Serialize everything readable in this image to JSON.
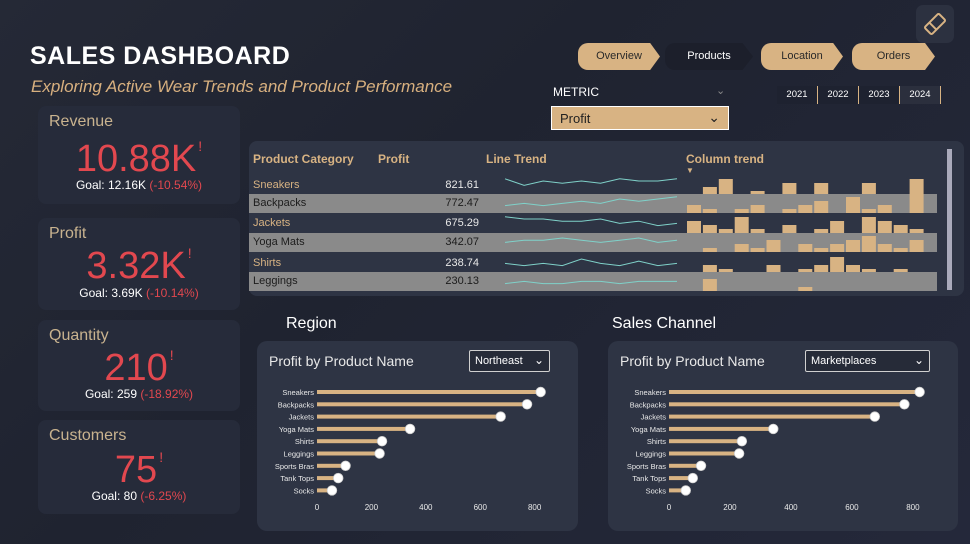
{
  "header": {
    "title": "SALES DASHBOARD",
    "subtitle": "Exploring Active Wear Trends and Product Performance"
  },
  "nav": [
    {
      "label": "Overview",
      "active": false
    },
    {
      "label": "Products",
      "active": true
    },
    {
      "label": "Location",
      "active": false
    },
    {
      "label": "Orders",
      "active": false
    }
  ],
  "metric": {
    "label": "METRIC",
    "selected": "Profit"
  },
  "years": [
    {
      "label": "2021",
      "selected": false
    },
    {
      "label": "2022",
      "selected": false
    },
    {
      "label": "2023",
      "selected": false
    },
    {
      "label": "2024",
      "selected": true
    }
  ],
  "kpis": [
    {
      "label": "Revenue",
      "value": "10.88K",
      "warn": "!",
      "goal_text": "Goal: 12.16K",
      "goal_pct": "(-10.54%)"
    },
    {
      "label": "Profit",
      "value": "3.32K",
      "warn": "!",
      "goal_text": "Goal: 3.69K",
      "goal_pct": "(-10.14%)"
    },
    {
      "label": "Quantity",
      "value": "210",
      "warn": "!",
      "goal_text": "Goal: 259",
      "goal_pct": "(-18.92%)"
    },
    {
      "label": "Customers",
      "value": "75",
      "warn": "!",
      "goal_text": "Goal: 80",
      "goal_pct": "(-6.25%)"
    }
  ],
  "table": {
    "headers": {
      "category": "Product Category",
      "profit": "Profit",
      "line": "Line Trend",
      "column": "Column trend"
    },
    "rows": [
      {
        "category": "Sneakers",
        "profit": "821.61",
        "line": [
          6,
          3,
          5,
          4,
          5,
          4,
          6,
          5,
          5,
          6
        ],
        "cols": [
          0,
          2,
          4,
          0,
          1,
          0,
          3,
          0,
          3,
          0,
          0,
          3,
          0,
          0,
          4
        ]
      },
      {
        "category": "Backpacks",
        "profit": "772.47",
        "line": [
          2,
          3,
          2,
          3,
          4,
          3,
          5,
          4,
          5,
          6
        ],
        "cols": [
          2,
          1,
          0,
          1,
          2,
          0,
          1,
          2,
          3,
          0,
          4,
          1,
          2,
          0,
          5
        ]
      },
      {
        "category": "Jackets",
        "profit": "675.29",
        "line": [
          6,
          5,
          5,
          4,
          4,
          5,
          3,
          4,
          2,
          3
        ],
        "cols": [
          3,
          2,
          1,
          4,
          1,
          0,
          2,
          0,
          1,
          3,
          0,
          4,
          3,
          2,
          1
        ]
      },
      {
        "category": "Yoga Mats",
        "profit": "342.07",
        "line": [
          3,
          4,
          4,
          5,
          4,
          3,
          4,
          5,
          3,
          4
        ],
        "cols": [
          0,
          1,
          0,
          2,
          1,
          3,
          0,
          2,
          1,
          2,
          3,
          4,
          2,
          1,
          3
        ]
      },
      {
        "category": "Shirts",
        "profit": "238.74",
        "line": [
          3,
          2,
          3,
          2,
          5,
          3,
          2,
          4,
          2,
          3
        ],
        "cols": [
          0,
          2,
          1,
          0,
          0,
          2,
          0,
          1,
          2,
          4,
          2,
          1,
          0,
          1,
          0
        ]
      },
      {
        "category": "Leggings",
        "profit": "230.13",
        "line": [
          2,
          3,
          2,
          2,
          3,
          3,
          2,
          3,
          3,
          3
        ],
        "cols": [
          0,
          3,
          0,
          0,
          0,
          0,
          0,
          1,
          0,
          0,
          0,
          0,
          0,
          0,
          0
        ]
      }
    ]
  },
  "region": {
    "section_title": "Region",
    "chart_title": "Profit by Product Name",
    "dropdown": "Northeast"
  },
  "channel": {
    "section_title": "Sales Channel",
    "chart_title": "Profit by Product Name",
    "dropdown": "Marketplaces"
  },
  "chart_data": [
    {
      "type": "bar",
      "orientation": "horizontal",
      "title": "Profit by Product Name",
      "categories": [
        "Sneakers",
        "Backpacks",
        "Jackets",
        "Yoga Mats",
        "Shirts",
        "Leggings",
        "Sports Bras",
        "Tank Tops",
        "Socks"
      ],
      "values": [
        822,
        772,
        675,
        342,
        239,
        230,
        105,
        78,
        55
      ],
      "xticks": [
        0,
        200,
        400,
        600,
        800
      ],
      "xlim": [
        0,
        860
      ]
    },
    {
      "type": "bar",
      "orientation": "horizontal",
      "title": "Profit by Product Name",
      "categories": [
        "Sneakers",
        "Backpacks",
        "Jackets",
        "Yoga Mats",
        "Shirts",
        "Leggings",
        "Sports Bras",
        "Tank Tops",
        "Socks"
      ],
      "values": [
        822,
        772,
        675,
        342,
        239,
        230,
        105,
        78,
        55
      ],
      "xticks": [
        0,
        200,
        400,
        600,
        800
      ],
      "xlim": [
        0,
        820
      ]
    }
  ],
  "colors": {
    "accent": "#d8b383",
    "alert": "#e2484f",
    "panel": "#2e3444",
    "trend_line": "#7fd1c9"
  }
}
